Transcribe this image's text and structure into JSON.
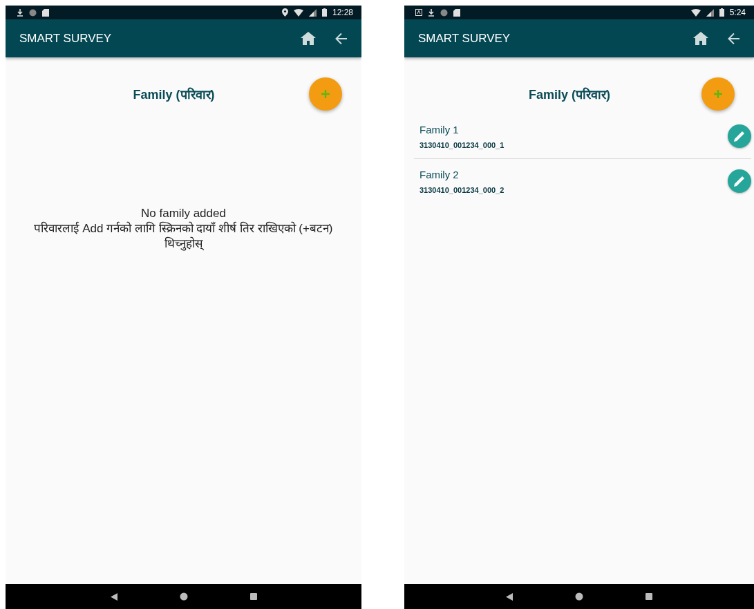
{
  "screens": [
    {
      "status_bar": {
        "left_icons": [
          {
            "kind": "download"
          },
          {
            "kind": "circle"
          },
          {
            "kind": "sd-card"
          }
        ],
        "right_icons": [
          {
            "kind": "location"
          },
          {
            "kind": "wifi"
          },
          {
            "kind": "signal"
          },
          {
            "kind": "battery"
          }
        ],
        "time": "12:28"
      },
      "app_bar": {
        "title": "SMART SURVEY"
      },
      "heading": "Family (परिवार)",
      "empty_message": {
        "title": "No family added",
        "hint": "परिवारलाई Add गर्नको लागि स्क्रिनको दायाँ शीर्ष तिर राखिएको (+बटन) थिच्नुहोस्"
      }
    },
    {
      "status_bar": {
        "left_icons": [
          {
            "kind": "keyboard"
          },
          {
            "kind": "download"
          },
          {
            "kind": "circle"
          },
          {
            "kind": "sd-card"
          }
        ],
        "right_icons": [
          {
            "kind": "wifi"
          },
          {
            "kind": "signal"
          },
          {
            "kind": "battery"
          }
        ],
        "time": "5:24"
      },
      "app_bar": {
        "title": "SMART SURVEY"
      },
      "heading": "Family (परिवार)",
      "families": [
        {
          "name": "Family 1",
          "code": "3130410_001234_000_1"
        },
        {
          "name": "Family 2",
          "code": "3130410_001234_000_2"
        }
      ]
    }
  ]
}
